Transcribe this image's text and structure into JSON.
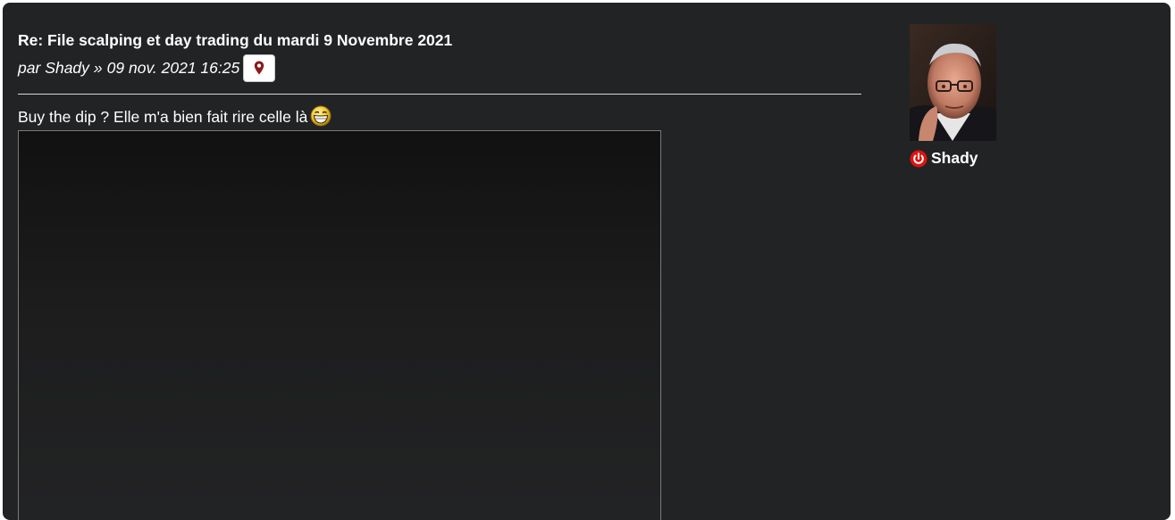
{
  "post": {
    "title": "Re: File scalping et day trading du mardi 9 Novembre 2021",
    "byline_prefix": "par",
    "author": "Shady",
    "separator": "»",
    "datetime": "09 nov. 2021 16:25",
    "location_icon": "map-pin-icon",
    "content_text": "Buy the dip ? Elle m'a bien fait rire celle là",
    "content_smiley": "laughing-smiley-icon"
  },
  "profile": {
    "username": "Shady",
    "status_icon": "power-offline-icon",
    "avatar": "avatar-photo"
  },
  "colors": {
    "panel_background": "#222325",
    "text": "#ffffff",
    "pin": "#8b1a1a",
    "status": "#e0120e"
  }
}
